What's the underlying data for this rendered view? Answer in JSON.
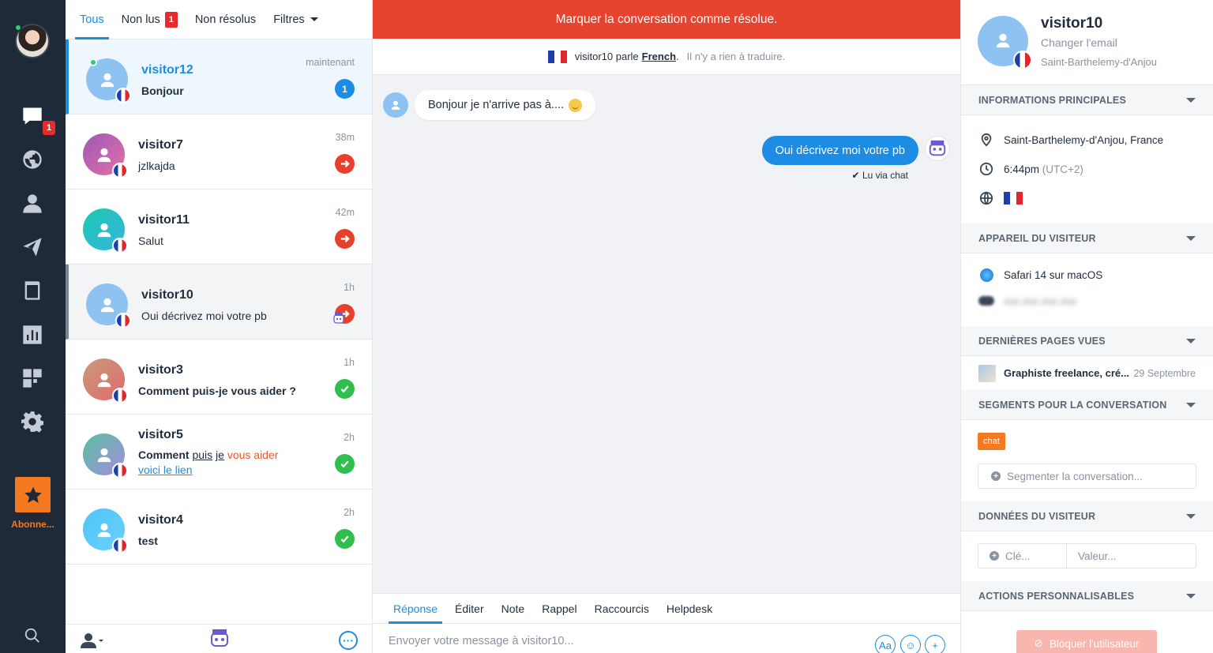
{
  "nav": {
    "badge": "1",
    "subscription_label": "Abonne...",
    "icons": [
      "chat-icon",
      "globe-icon",
      "user-icon",
      "send-icon",
      "book-icon",
      "chart-icon",
      "apps-icon",
      "gear-icon",
      "star-icon",
      "search-icon"
    ]
  },
  "list": {
    "tabs": [
      {
        "label": "Tous"
      },
      {
        "label": "Non lus",
        "badge": "1"
      },
      {
        "label": "Non résolus"
      },
      {
        "label": "Filtres"
      }
    ],
    "conversations": [
      {
        "name": "visitor12",
        "message": "Bonjour",
        "time": "maintenant",
        "count": "1"
      },
      {
        "name": "visitor7",
        "message": "jzlkajda",
        "time": "38m"
      },
      {
        "name": "visitor11",
        "message": "Salut",
        "time": "42m"
      },
      {
        "name": "visitor10",
        "message": "Oui décrivez moi votre pb",
        "time": "1h"
      },
      {
        "name": "visitor3",
        "message": "Comment puis-je vous aider ?",
        "time": "1h"
      },
      {
        "name": "visitor5",
        "message_parts": [
          "Comment",
          "puis",
          "je",
          "vous aider"
        ],
        "link": "voici le lien",
        "time": "2h"
      },
      {
        "name": "visitor4",
        "message": "test",
        "time": "2h"
      }
    ]
  },
  "chat": {
    "resolve_banner": "Marquer la conversation comme résolue.",
    "translation": {
      "speaker": "visitor10 parle",
      "language": "French",
      "dot": ".",
      "note": "Il n'y a rien à traduire."
    },
    "incoming": "Bonjour je n'arrive pas à....",
    "outgoing": "Oui décrivez moi votre pb",
    "read_receipt": "Lu via chat",
    "composer_tabs": [
      "Réponse",
      "Éditer",
      "Note",
      "Rappel",
      "Raccourcis",
      "Helpdesk"
    ],
    "placeholder": "Envoyer votre message à visitor10...",
    "format_button": "Aa"
  },
  "visitor": {
    "name": "visitor10",
    "change_email": "Changer l'email",
    "city": "Saint-Barthelemy-d'Anjou",
    "sections": {
      "main_info": "INFORMATIONS PRINCIPALES",
      "device": "APPAREIL DU VISITEUR",
      "pages": "DERNIÈRES PAGES VUES",
      "segments": "SEGMENTS POUR LA CONVERSATION",
      "data": "DONNÉES DU VISITEUR",
      "actions": "ACTIONS PERSONNALISABLES"
    },
    "location": "Saint-Barthelemy-d'Anjou, France",
    "local_time": "6:44pm",
    "timezone": "(UTC+2)",
    "browser": "Safari 14 sur macOS",
    "ip": "xxx.xxx.xxx.xxx",
    "page_title": "Graphiste freelance, cré...",
    "page_date": "29 Septembre",
    "segment_tag": "chat",
    "segment_placeholder": "Segmenter la conversation...",
    "key_placeholder": "Clé...",
    "value_placeholder": "Valeur...",
    "block_button": "Bloquer l'utilisateur"
  }
}
